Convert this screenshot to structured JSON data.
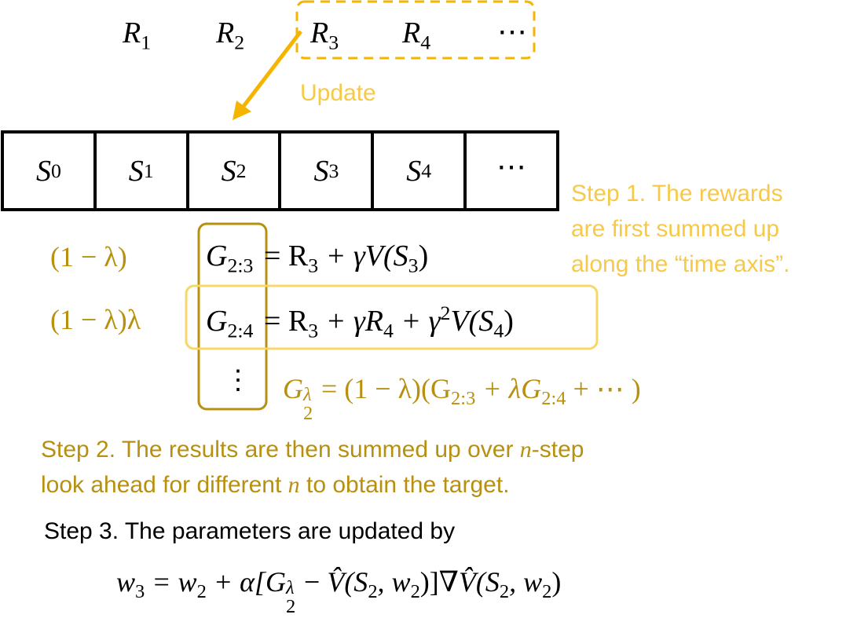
{
  "rewards": [
    {
      "sym": "R",
      "sub": "1"
    },
    {
      "sym": "R",
      "sub": "2"
    },
    {
      "sym": "R",
      "sub": "3"
    },
    {
      "sym": "R",
      "sub": "4"
    },
    {
      "sym": "⋯",
      "sub": ""
    }
  ],
  "update_label": "Update",
  "states": [
    {
      "sym": "S",
      "sub": "0"
    },
    {
      "sym": "S",
      "sub": "1"
    },
    {
      "sym": "S",
      "sub": "2"
    },
    {
      "sym": "S",
      "sub": "3"
    },
    {
      "sym": "S",
      "sub": "4"
    },
    {
      "sym": "⋯",
      "sub": ""
    }
  ],
  "step1": {
    "lines": [
      "Step 1. The rewards",
      "are first summed up",
      "along the “time axis”."
    ]
  },
  "weights": {
    "w1": "(1 − λ)",
    "w2": "(1 − λ)λ"
  },
  "equations": {
    "g23_lhs_sym": "G",
    "g23_lhs_sub": "2:3",
    "g23_rhs": "= R",
    "g23_r_sub": "3",
    "g23_mid": " + γV(S",
    "g23_s_sub": "3",
    "g23_end": ")",
    "g24_lhs_sym": "G",
    "g24_lhs_sub": "2:4",
    "g24_a": "= R",
    "g24_a_sub": "3",
    "g24_b": " + γR",
    "g24_b_sub": "4",
    "g24_c": " + γ",
    "g24_c_sup": "2",
    "g24_d": "V(S",
    "g24_d_sub": "4",
    "g24_e": ")",
    "vdots": "⋮"
  },
  "lambda_return": {
    "g": "G",
    "sup": "λ",
    "sub": "2",
    "eq": " = (1 − λ)(",
    "g1": "G",
    "g1_sub": "2:3",
    "plus": " + λ",
    "g2": "G",
    "g2_sub": "2:4",
    "tail": " + ⋯ )"
  },
  "step2": {
    "line1_a": "Step 2. The results are then summed up over ",
    "line1_n": "n",
    "line1_b": "-step",
    "line2_a": "look ahead for different ",
    "line2_n": "n",
    "line2_b": " to obtain the target."
  },
  "step3": {
    "text": "Step 3. The parameters are updated by"
  },
  "update_eq": {
    "w3": "w",
    "w3_sub": "3",
    "eq1": " = w",
    "w2_sub": "2",
    "plus_alpha": " + α[",
    "g": "G",
    "g_sup": "λ",
    "g_sub": "2",
    "minus": " − ",
    "vhat": "V̂",
    "paren1": "(S",
    "s_sub": "2",
    "comma1": ", w",
    "w_sub_a": "2",
    "close1": ")]∇",
    "vhat2": "V̂",
    "paren2": "(S",
    "s_sub2": "2",
    "comma2": ", w",
    "w_sub_b": "2",
    "close2": ")"
  },
  "colors": {
    "gold": "#b8900f",
    "light_gold": "#f7c948",
    "dashed_box": "#f5b400",
    "arrow": "#f5b400",
    "box_gold": "#b8900f"
  }
}
